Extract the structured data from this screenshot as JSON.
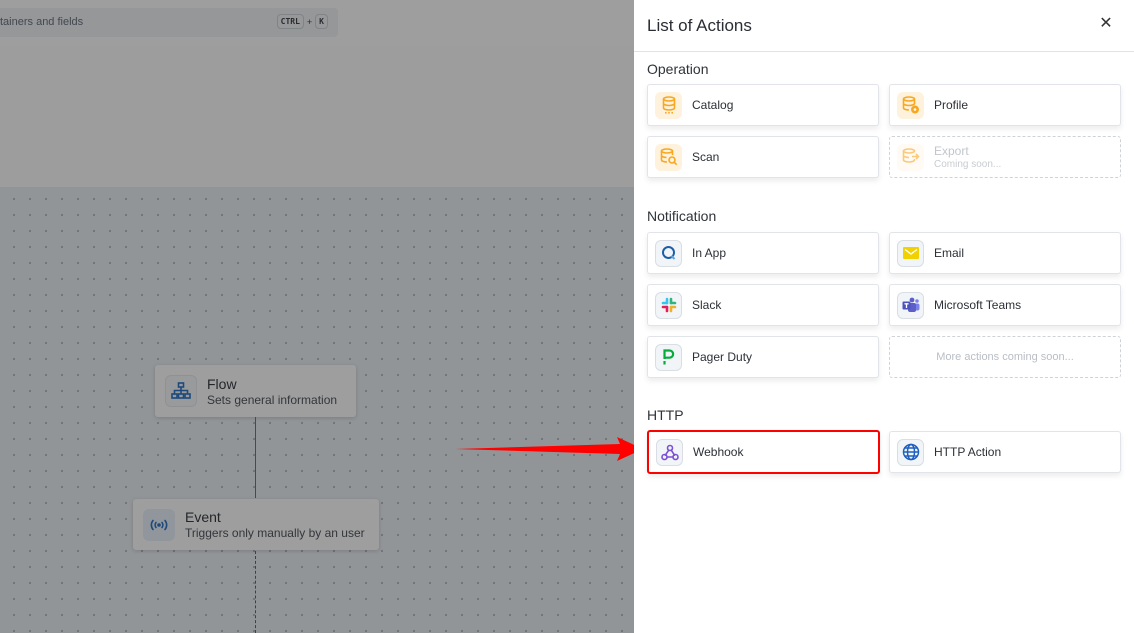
{
  "background": {
    "search": {
      "placeholder": "tainers and fields",
      "shortcut_keys": [
        "CTRL",
        "K"
      ],
      "shortcut_joiner": "+"
    },
    "flow_nodes": [
      {
        "title": "Flow",
        "subtitle": "Sets general information",
        "icon": "sitemap-icon"
      },
      {
        "title": "Event",
        "subtitle": "Triggers only manually by an user",
        "icon": "broadcast-icon"
      }
    ]
  },
  "panel": {
    "title": "List of Actions",
    "close_icon": "close-icon",
    "sections": [
      {
        "label": "Operation",
        "items": [
          {
            "label": "Catalog",
            "icon": "database-icon"
          },
          {
            "label": "Profile",
            "icon": "database-eye-icon"
          },
          {
            "label": "Scan",
            "icon": "database-search-icon"
          },
          {
            "label": "Export",
            "sublabel": "Coming soon...",
            "icon": "database-export-icon",
            "disabled": true
          }
        ]
      },
      {
        "label": "Notification",
        "items": [
          {
            "label": "In App",
            "icon": "in-app-icon"
          },
          {
            "label": "Email",
            "icon": "email-icon"
          },
          {
            "label": "Slack",
            "icon": "slack-icon"
          },
          {
            "label": "Microsoft Teams",
            "icon": "teams-icon"
          },
          {
            "label": "Pager Duty",
            "icon": "pagerduty-icon"
          },
          {
            "label": "More actions coming soon...",
            "placeholder": true
          }
        ]
      },
      {
        "label": "HTTP",
        "items": [
          {
            "label": "Webhook",
            "icon": "webhook-icon",
            "highlighted": true
          },
          {
            "label": "HTTP Action",
            "icon": "globe-icon"
          }
        ]
      }
    ]
  },
  "annotation": {
    "arrow_color": "#ff0000",
    "highlight_color": "#ff0000"
  }
}
